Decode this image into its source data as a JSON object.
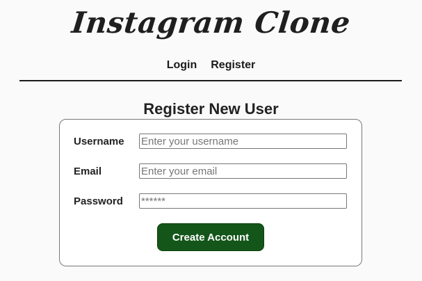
{
  "header": {
    "brand_title": "Instagram Clone"
  },
  "nav": {
    "items": [
      {
        "label": "Login"
      },
      {
        "label": "Register"
      }
    ]
  },
  "main": {
    "page_title": "Register New User",
    "form": {
      "fields": [
        {
          "label": "Username",
          "placeholder": "Enter your username",
          "value": ""
        },
        {
          "label": "Email",
          "placeholder": "Enter your email",
          "value": ""
        },
        {
          "label": "Password",
          "placeholder": "******",
          "value": ""
        }
      ],
      "submit_label": "Create Account"
    }
  },
  "colors": {
    "background": "#fafafa",
    "card_background": "#ffffff",
    "button_background": "#14561a",
    "button_text": "#ffffff",
    "text": "#222222"
  }
}
